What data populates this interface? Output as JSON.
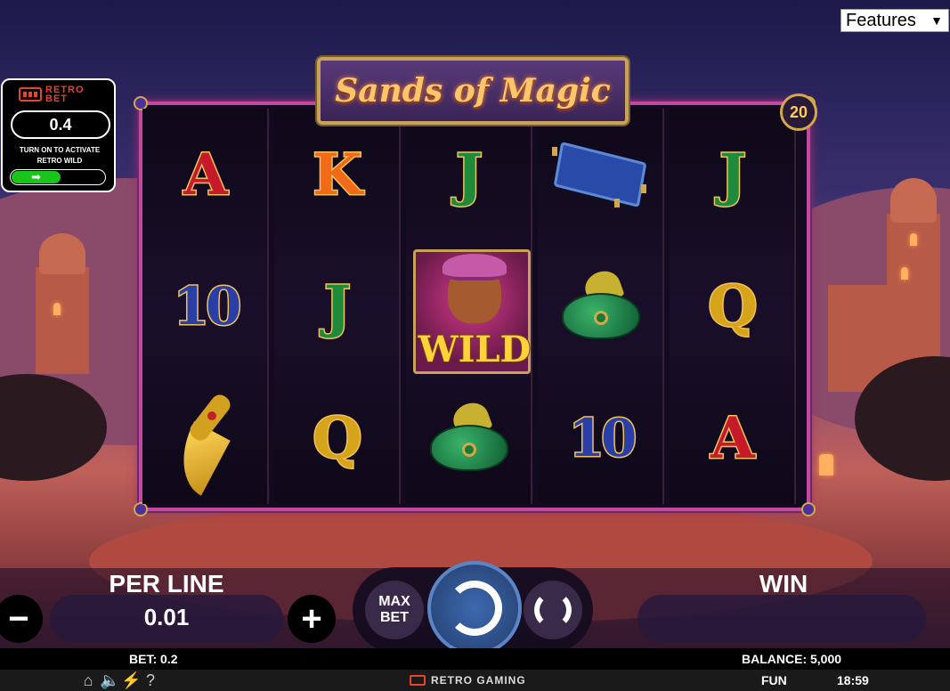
{
  "features_select": {
    "selected": "Features"
  },
  "retro_bet": {
    "logo_line1": "RETRO",
    "logo_line2": "BET",
    "value": "0.4",
    "caption_line1": "TURN ON TO ACTIVATE",
    "caption_line2": "RETRO WILD",
    "toggle_icon": "arrow-right-icon",
    "toggle_arrow": "➡",
    "toggle_color": "#19c51b"
  },
  "game_title": "Sands of Magic",
  "paylines": "20",
  "reels": [
    [
      {
        "symbol": "letter",
        "text": "A",
        "color": "red"
      },
      {
        "symbol": "ten",
        "text": "10"
      },
      {
        "symbol": "dagger"
      }
    ],
    [
      {
        "symbol": "letter",
        "text": "K",
        "color": "orange"
      },
      {
        "symbol": "letter",
        "text": "J",
        "color": "green"
      },
      {
        "symbol": "letter",
        "text": "Q",
        "color": "gold"
      }
    ],
    [
      {
        "symbol": "letter",
        "text": "J",
        "color": "green"
      },
      {
        "symbol": "wild",
        "text": "WILD"
      },
      {
        "symbol": "turban"
      }
    ],
    [
      {
        "symbol": "carpet"
      },
      {
        "symbol": "turban"
      },
      {
        "symbol": "ten",
        "text": "10"
      }
    ],
    [
      {
        "symbol": "letter",
        "text": "J",
        "color": "green"
      },
      {
        "symbol": "letter",
        "text": "Q",
        "color": "gold"
      },
      {
        "symbol": "letter",
        "text": "A",
        "color": "red"
      }
    ]
  ],
  "controls": {
    "per_line_label": "PER LINE",
    "per_line_value": "0.01",
    "minus_label": "−",
    "plus_label": "+",
    "max_bet_line1": "MAX",
    "max_bet_line2": "BET",
    "win_label": "WIN",
    "win_value": ""
  },
  "status": {
    "bet_label": "BET:",
    "bet_value": "0.2",
    "balance_label": "BALANCE:",
    "balance_value": "5,000",
    "mode": "FUN",
    "time": "18:59",
    "footer_logo": "RETRO GAMING",
    "icons": [
      "home-icon",
      "sound-icon",
      "speed-icon",
      "help-icon"
    ],
    "help_glyph": "?"
  },
  "colors": {
    "frame_border": "#c24aa0",
    "banner_border": "#c9a25a",
    "spin_button": "#3c6ab0",
    "retro_red": "#e8432b"
  }
}
